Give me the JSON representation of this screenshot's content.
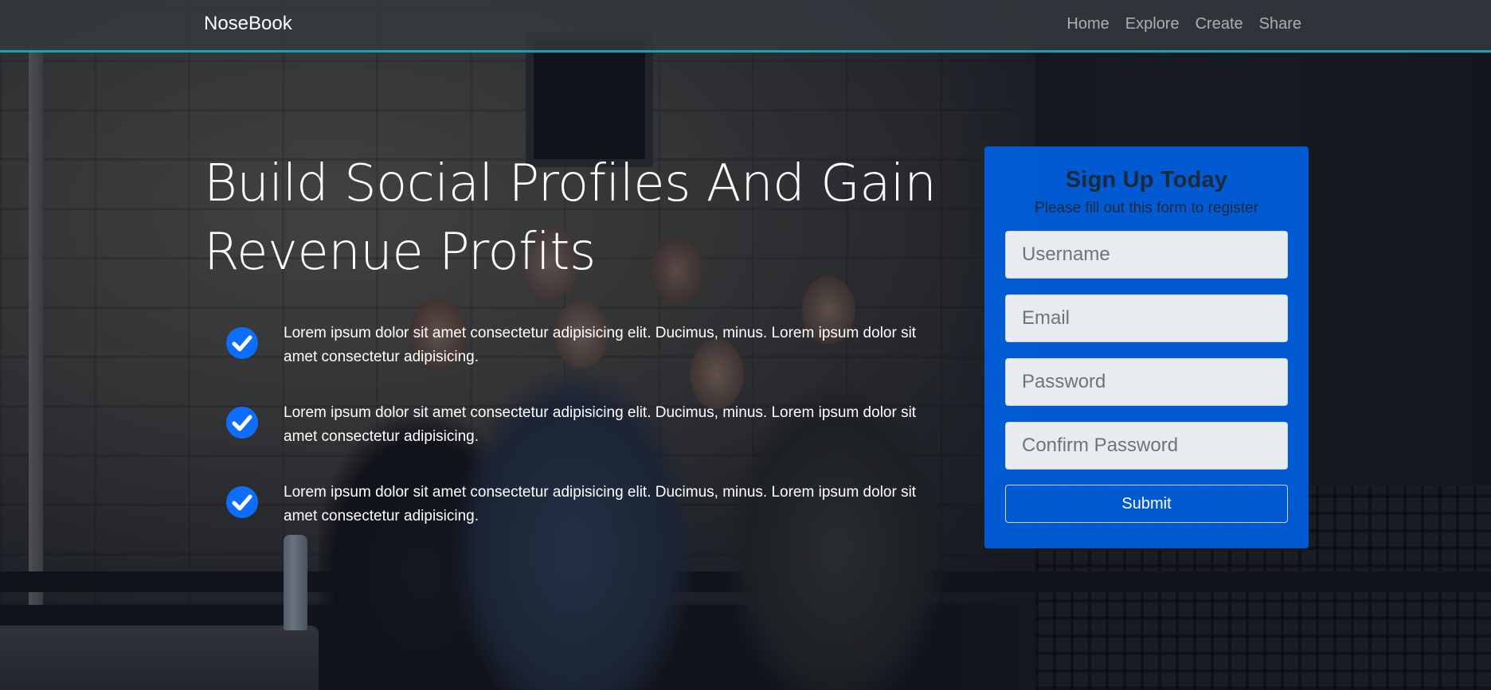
{
  "navbar": {
    "brand": "NoseBook",
    "links": [
      "Home",
      "Explore",
      "Create",
      "Share"
    ],
    "accent_color": "#17a2b8"
  },
  "hero": {
    "title": "Build Social Profiles And Gain Revenue Profits",
    "features": [
      {
        "icon": "check-circle-icon",
        "text": "Lorem ipsum dolor sit amet consectetur adipisicing elit. Ducimus, minus. Lorem ipsum dolor sit amet consectetur adipisicing."
      },
      {
        "icon": "check-circle-icon",
        "text": "Lorem ipsum dolor sit amet consectetur adipisicing elit. Ducimus, minus. Lorem ipsum dolor sit amet consectetur adipisicing."
      },
      {
        "icon": "check-circle-icon",
        "text": "Lorem ipsum dolor sit amet consectetur adipisicing elit. Ducimus, minus. Lorem ipsum dolor sit amet consectetur adipisicing."
      }
    ],
    "icon_color": "#0d6efd"
  },
  "signup": {
    "title": "Sign Up Today",
    "subtitle": "Please fill out this form to register",
    "fields": {
      "username": {
        "placeholder": "Username",
        "value": ""
      },
      "email": {
        "placeholder": "Email",
        "value": ""
      },
      "password": {
        "placeholder": "Password",
        "value": ""
      },
      "confirm_password": {
        "placeholder": "Confirm Password",
        "value": ""
      }
    },
    "submit_label": "Submit",
    "card_color": "#0062e6"
  }
}
